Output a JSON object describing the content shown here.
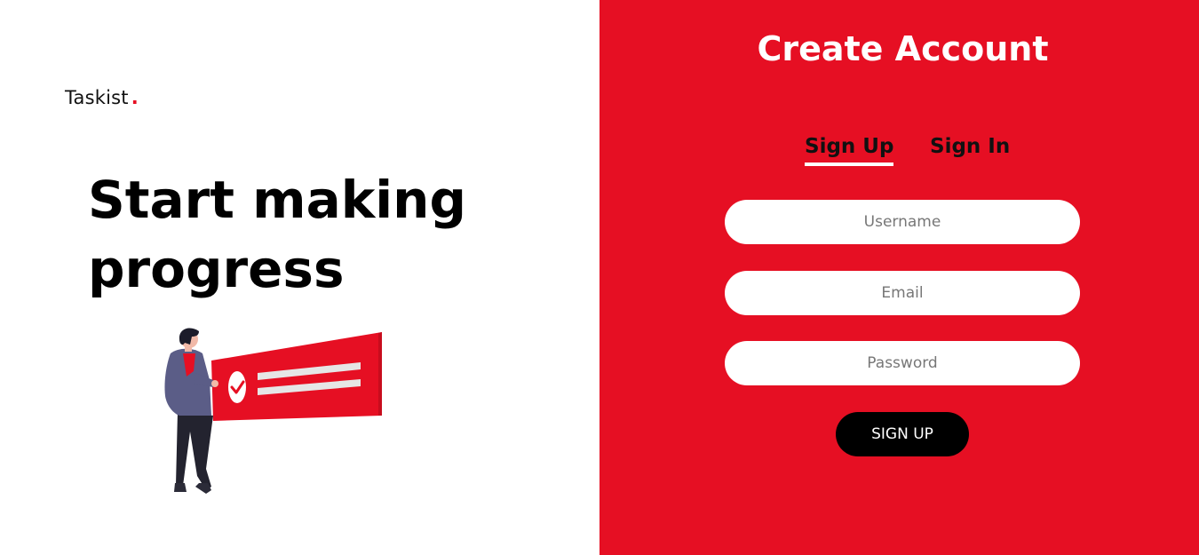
{
  "brand": {
    "name": "Taskist",
    "dot": "."
  },
  "hero": {
    "headline_line1": "Start making",
    "headline_line2": "progress"
  },
  "form": {
    "title": "Create Account",
    "tabs": [
      {
        "label": "Sign Up",
        "active": true
      },
      {
        "label": "Sign In",
        "active": false
      }
    ],
    "fields": {
      "username": {
        "placeholder": "Username",
        "value": ""
      },
      "email": {
        "placeholder": "Email",
        "value": ""
      },
      "password": {
        "placeholder": "Password",
        "value": ""
      }
    },
    "submit_label": "SIGN UP"
  },
  "colors": {
    "accent": "#e60f23",
    "panel_bg": "#e60f23",
    "button_bg": "#000000",
    "input_bg": "#ffffff",
    "jacket": "#5b5d87",
    "pants": "#23232f"
  },
  "illustration": {
    "icon": "person-holding-checklist-illustration"
  }
}
